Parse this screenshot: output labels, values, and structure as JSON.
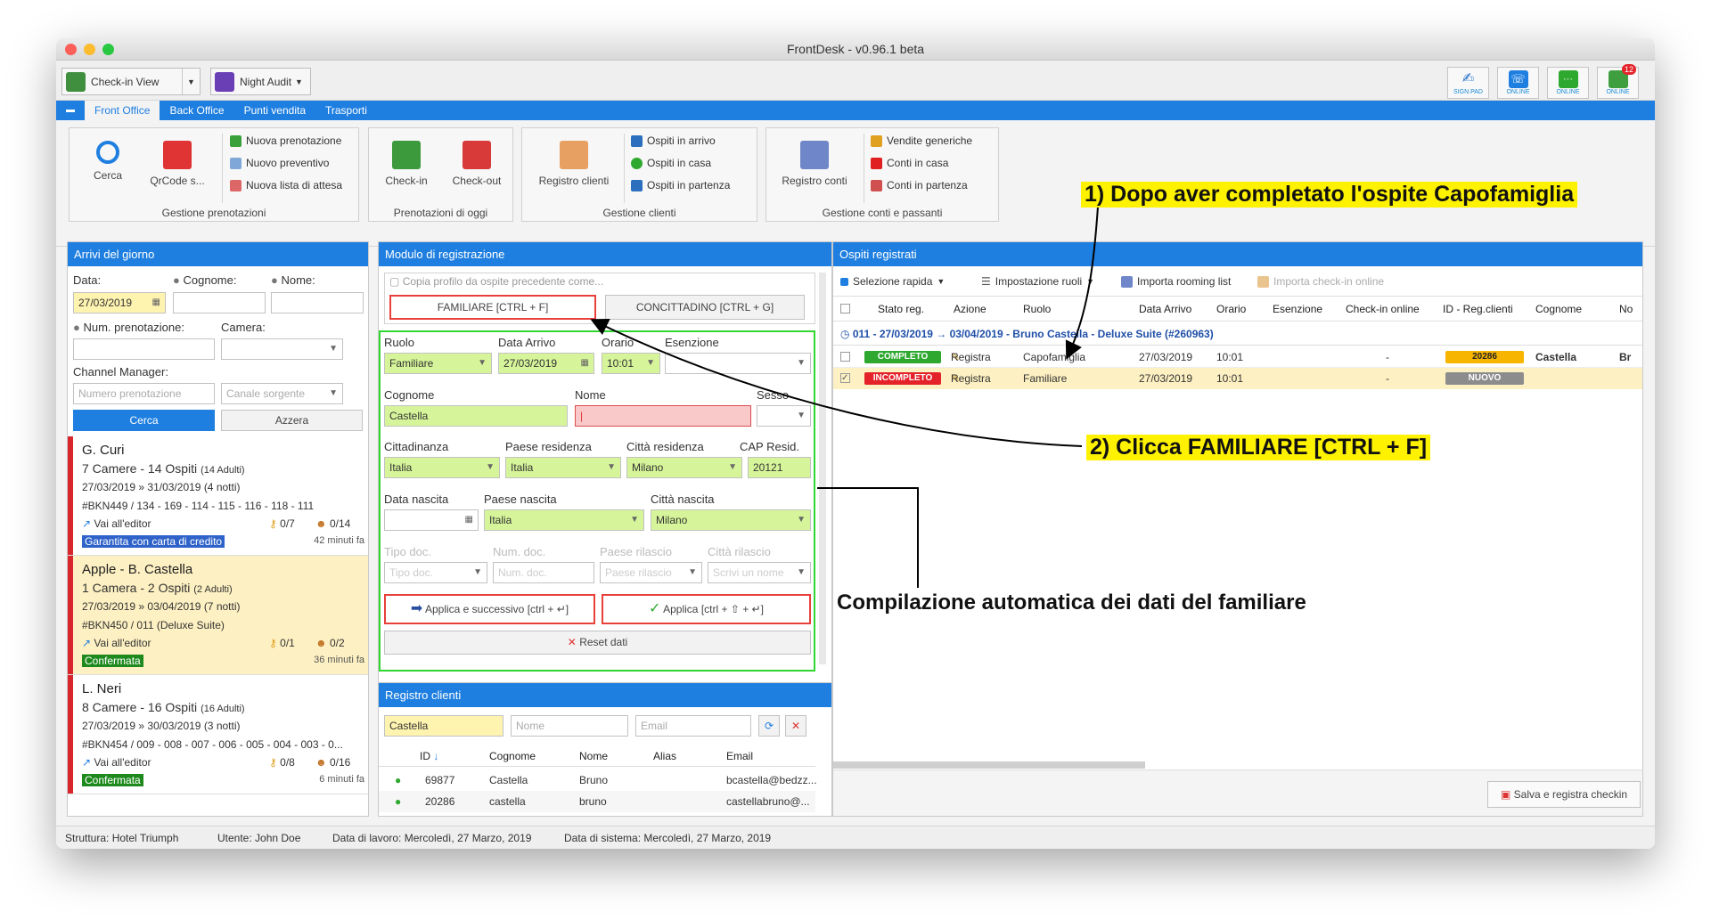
{
  "app": {
    "title": "FrontDesk - v0.96.1 beta"
  },
  "toolbar": {
    "checkin_view": "Check-in View",
    "night_audit": "Night Audit",
    "signpad": "SIGN.PAD",
    "online1": "ONLINE",
    "online2": "ONLINE",
    "online3": "ONLINE",
    "badge": "12"
  },
  "menu": {
    "front_office": "Front Office",
    "back_office": "Back Office",
    "punti_vendita": "Punti vendita",
    "trasporti": "Trasporti"
  },
  "ribbon": {
    "cerca": "Cerca",
    "qrcode": "QrCode s...",
    "nuova_prenotazione": "Nuova prenotazione",
    "nuovo_preventivo": "Nuovo preventivo",
    "nuova_lista": "Nuova lista di attesa",
    "g1": "Gestione prenotazioni",
    "checkin": "Check-in",
    "checkout": "Check-out",
    "g2": "Prenotazioni di oggi",
    "registro_clienti": "Registro clienti",
    "ospiti_arrivo": "Ospiti in arrivo",
    "ospiti_casa": "Ospiti in casa",
    "ospiti_partenza": "Ospiti in partenza",
    "g3": "Gestione clienti",
    "registro_conti": "Registro conti",
    "vendite": "Vendite generiche",
    "conti_casa": "Conti in casa",
    "conti_partenza": "Conti in partenza",
    "g4": "Gestione conti e passanti"
  },
  "arrivi": {
    "title": "Arrivi del giorno",
    "data_label": "Data:",
    "data_value": "27/03/2019",
    "cognome_label": "Cognome:",
    "nome_label": "Nome:",
    "num_label": "Num. prenotazione:",
    "camera_label": "Camera:",
    "channel_label": "Channel Manager:",
    "num_placeholder": "Numero prenotazione",
    "canale_placeholder": "Canale sorgente",
    "cerca": "Cerca",
    "azzera": "Azzera",
    "items": [
      {
        "name": "G. Curi",
        "camere": "7 Camere - 14 Ospiti",
        "ospiti_detail": "(14 Adulti)",
        "dates": "27/03/2019 » 31/03/2019",
        "notti": "(4 notti)",
        "rooms": "#BKN449 / 134 - 169 - 114 - 115 - 116 - 118 - 111",
        "editor": "Vai all'editor",
        "keys": "0/7",
        "guests": "0/14",
        "tag": "Garantita con carta di credito",
        "time": "42 minuti fa"
      },
      {
        "name": "Apple - B. Castella",
        "camere": "1 Camera - 2 Ospiti",
        "ospiti_detail": "(2 Adulti)",
        "dates": "27/03/2019 » 03/04/2019",
        "notti": "(7 notti)",
        "rooms": "#BKN450 / 011 (Deluxe Suite)",
        "editor": "Vai all'editor",
        "keys": "0/1",
        "guests": "0/2",
        "tag": "Confermata",
        "time": "36 minuti fa"
      },
      {
        "name": "L. Neri",
        "camere": "8 Camere - 16 Ospiti",
        "ospiti_detail": "(16 Adulti)",
        "dates": "27/03/2019 » 30/03/2019",
        "notti": "(3 notti)",
        "rooms": "#BKN454 / 009 - 008 - 007 - 006 - 005 - 004 - 003 - 0...",
        "editor": "Vai all'editor",
        "keys": "0/8",
        "guests": "0/16",
        "tag": "Confermata",
        "time": "6 minuti fa"
      }
    ]
  },
  "modulo": {
    "title": "Modulo di registrazione",
    "copia": "Copia profilo da ospite precedente come...",
    "familiare": "FAMILIARE [CTRL + F]",
    "concittadino": "CONCITTADINO [CTRL + G]",
    "ruolo_l": "Ruolo",
    "ruolo": "Familiare",
    "data_arrivo_l": "Data Arrivo",
    "data_arrivo": "27/03/2019",
    "orario_l": "Orario",
    "orario": "10:01",
    "esenzione_l": "Esenzione",
    "cognome_l": "Cognome",
    "cognome": "Castella",
    "nome_l": "Nome",
    "sesso_l": "Sesso",
    "cittadinanza_l": "Cittadinanza",
    "cittadinanza": "Italia",
    "paese_res_l": "Paese residenza",
    "paese_res": "Italia",
    "citta_res_l": "Città residenza",
    "citta_res": "Milano",
    "cap_l": "CAP Resid.",
    "cap": "20121",
    "data_nascita_l": "Data nascita",
    "paese_nascita_l": "Paese nascita",
    "paese_nascita": "Italia",
    "citta_nascita_l": "Città nascita",
    "citta_nascita": "Milano",
    "tipo_doc_l": "Tipo doc.",
    "tipo_doc_ph": "Tipo doc.",
    "num_doc_l": "Num. doc.",
    "num_doc_ph": "Num. doc.",
    "paese_ril_l": "Paese rilascio",
    "paese_ril_ph": "Paese rilascio",
    "citta_ril_l": "Città rilascio",
    "citta_ril_ph": "Scrivi un nome",
    "applica_succ": "Applica e successivo [ctrl + ↵]",
    "applica": "Applica [ctrl + ⇧ + ↵]",
    "reset": "Reset dati"
  },
  "registro": {
    "title": "Registro clienti",
    "search": "Castella",
    "nome_ph": "Nome",
    "email_ph": "Email",
    "cols": [
      "ID",
      "Cognome",
      "Nome",
      "Alias",
      "Email"
    ],
    "rows": [
      [
        "69877",
        "Castella",
        "Bruno",
        "",
        "bcastella@bedzz..."
      ],
      [
        "20286",
        "castella",
        "bruno",
        "",
        "castellabruno@..."
      ]
    ]
  },
  "ospiti": {
    "title": "Ospiti registrati",
    "selezione": "Selezione rapida",
    "impostazione": "Impostazione ruoli",
    "importa": "Importa rooming list",
    "importa_online": "Importa check-in online",
    "cols": [
      "Stato reg.",
      "Azione",
      "Ruolo",
      "Data Arrivo",
      "Orario",
      "Esenzione",
      "Check-in online",
      "ID - Reg.clienti",
      "Cognome",
      "No"
    ],
    "group": "011 - 27/03/2019 → 03/04/2019 - Bruno Castella - Deluxe Suite (#260963)",
    "rows": [
      {
        "stato": "COMPLETO",
        "azione": "Registra",
        "ruolo": "Capofamiglia",
        "data": "27/03/2019",
        "orario": "10:01",
        "checkin": "-",
        "id": "20286",
        "cognome": "Castella",
        "no": "Br"
      },
      {
        "stato": "INCOMPLETO",
        "azione": "Registra",
        "ruolo": "Familiare",
        "data": "27/03/2019",
        "orario": "10:01",
        "checkin": "-",
        "id": "NUOVO",
        "cognome": "",
        "no": ""
      }
    ],
    "salva": "Salva e registra checkin"
  },
  "status": {
    "struttura": "Struttura: Hotel Triumph",
    "utente": "Utente: John Doe",
    "lavoro": "Data di lavoro: Mercoledì, 27 Marzo, 2019",
    "sistema": "Data di sistema: Mercoledì, 27 Marzo, 2019"
  },
  "annotations": {
    "a1": "1) Dopo aver completato l'ospite Capofamiglia",
    "a2": "2) Clicca FAMILIARE [CTRL + F]",
    "a3": "Compilazione automatica dei dati del familiare"
  },
  "colors": {
    "accent": "#1f7fe0",
    "success": "#2ea82e",
    "danger": "#e4222a",
    "highlight": "#fff200"
  }
}
